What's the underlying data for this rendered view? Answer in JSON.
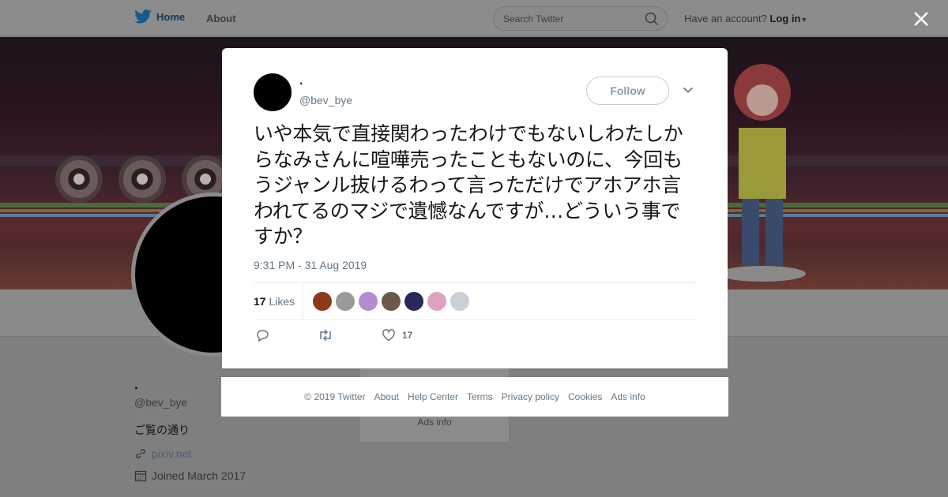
{
  "nav": {
    "home_label": "Home",
    "about_label": "About",
    "search_placeholder": "Search Twitter",
    "account_prompt": "Have an account?",
    "login_label": "Log in"
  },
  "profile": {
    "name": ".",
    "handle": "@bev_bye",
    "bio": "ご覧の通り",
    "link": "pixiv.net",
    "joined": "Joined March 2017",
    "sidebar_ads": "Ads info"
  },
  "tweet": {
    "author_name": ".",
    "author_handle": "@bev_bye",
    "follow_label": "Follow",
    "text": "いや本気で直接関わったわけでもないしわたしからなみさんに喧嘩売ったこともないのに、今回もうジャンル抜けるわって言っただけでアホアホ言われてるのマジで遺憾なんですが…どういう事ですか？",
    "timestamp": "9:31 PM - 31 Aug 2019",
    "likes_count": "17",
    "likes_label": "Likes",
    "action_like_count": "17",
    "liker_colors": [
      "#8a3a1a",
      "#9a9a9a",
      "#b48ad0",
      "#6a5a4a",
      "#2a2a5a",
      "#e0a0c0",
      "#c8d0d8"
    ]
  },
  "footer": {
    "links": [
      "© 2019 Twitter",
      "About",
      "Help Center",
      "Terms",
      "Privacy policy",
      "Cookies",
      "Ads info"
    ]
  },
  "colors": {
    "brand": "#1da1f2",
    "text_secondary": "#657786"
  }
}
